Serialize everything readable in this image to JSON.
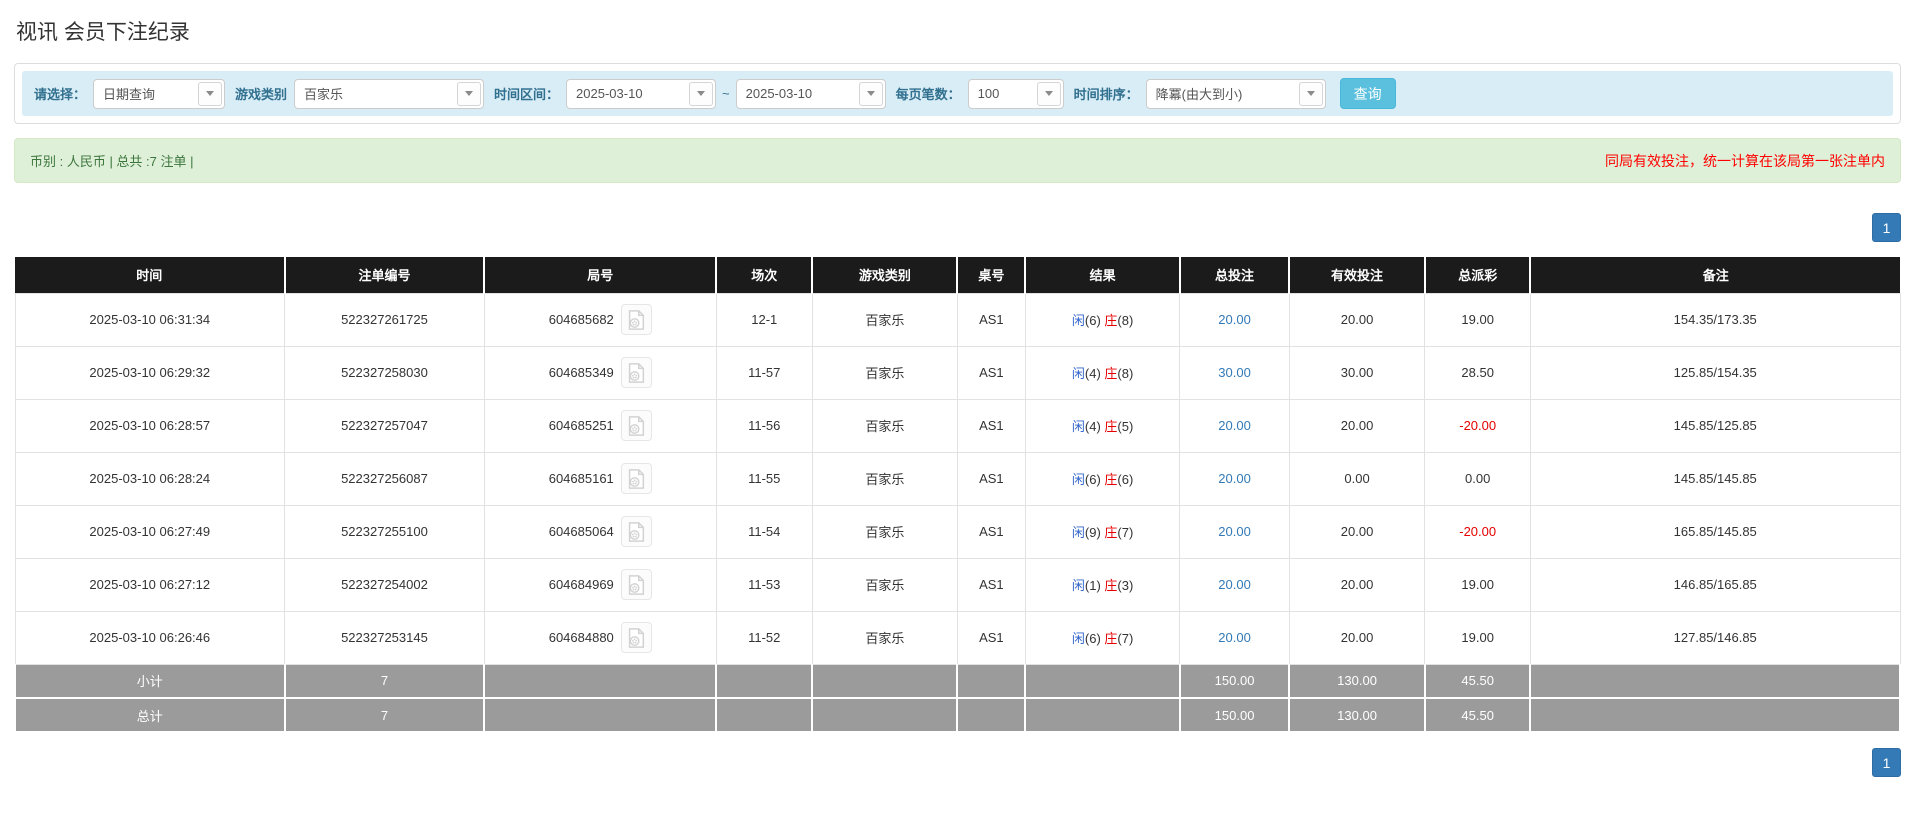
{
  "page_title": "视讯 会员下注纪录",
  "colors": {
    "accent_blue": "#337ab7",
    "search_button_blue": "#5bc0de",
    "player_blue": "#3366cc",
    "banker_red": "#e60000",
    "negative_red": "#e60000",
    "notice_red": "#ff0000",
    "summary_green_bg": "#dff0d8",
    "filter_bar_bg": "#d9edf7",
    "header_black": "#1b1b1b",
    "footer_gray": "#9b9b9b"
  },
  "filters": {
    "query_type": {
      "label": "请选择：",
      "value": "日期查询"
    },
    "game_type": {
      "label": "游戏类别",
      "value": "百家乐"
    },
    "time_range": {
      "label": "时间区间：",
      "from": "2025-03-10",
      "separator": "~",
      "to": "2025-03-10"
    },
    "page_size": {
      "label": "每页笔数：",
      "value": "100"
    },
    "time_sort": {
      "label": "时间排序：",
      "value": "降冪(由大到小)"
    },
    "search_button": "查询"
  },
  "summary_bar": {
    "info": "币别 : 人民币 | 总共 :7 注单 |",
    "notice": "同局有效投注，统一计算在该局第一张注单内"
  },
  "pagination": {
    "page": "1"
  },
  "table": {
    "columns": [
      {
        "key": "time",
        "label": "时间",
        "width": "14.3%"
      },
      {
        "key": "bet_no",
        "label": "注单编号",
        "width": "10.6%"
      },
      {
        "key": "round_no",
        "label": "局号",
        "width": "12.3%"
      },
      {
        "key": "session",
        "label": "场次",
        "width": "5.1%"
      },
      {
        "key": "game",
        "label": "游戏类别",
        "width": "7.7%"
      },
      {
        "key": "table_no",
        "label": "桌号",
        "width": "3.6%"
      },
      {
        "key": "result",
        "label": "结果",
        "width": "8.2%"
      },
      {
        "key": "total_bet",
        "label": "总投注",
        "width": "5.8%"
      },
      {
        "key": "valid_bet",
        "label": "有效投注",
        "width": "7.2%"
      },
      {
        "key": "payout",
        "label": "总派彩",
        "width": "5.6%"
      },
      {
        "key": "remark",
        "label": "备注",
        "width": "19.6%"
      }
    ],
    "rows": [
      {
        "time": "2025-03-10 06:31:34",
        "bet_no": "522327261725",
        "round_no": "604685682",
        "session": "12-1",
        "game": "百家乐",
        "table_no": "AS1",
        "result": {
          "player": "闲",
          "player_n": "(6)",
          "banker": "庄",
          "banker_n": "(8)"
        },
        "total_bet": "20.00",
        "valid_bet": "20.00",
        "payout": "19.00",
        "remark": "154.35/173.35"
      },
      {
        "time": "2025-03-10 06:29:32",
        "bet_no": "522327258030",
        "round_no": "604685349",
        "session": "11-57",
        "game": "百家乐",
        "table_no": "AS1",
        "result": {
          "player": "闲",
          "player_n": "(4)",
          "banker": "庄",
          "banker_n": "(8)"
        },
        "total_bet": "30.00",
        "valid_bet": "30.00",
        "payout": "28.50",
        "remark": "125.85/154.35"
      },
      {
        "time": "2025-03-10 06:28:57",
        "bet_no": "522327257047",
        "round_no": "604685251",
        "session": "11-56",
        "game": "百家乐",
        "table_no": "AS1",
        "result": {
          "player": "闲",
          "player_n": "(4)",
          "banker": "庄",
          "banker_n": "(5)"
        },
        "total_bet": "20.00",
        "valid_bet": "20.00",
        "payout": "-20.00",
        "remark": "145.85/125.85"
      },
      {
        "time": "2025-03-10 06:28:24",
        "bet_no": "522327256087",
        "round_no": "604685161",
        "session": "11-55",
        "game": "百家乐",
        "table_no": "AS1",
        "result": {
          "player": "闲",
          "player_n": "(6)",
          "banker": "庄",
          "banker_n": "(6)"
        },
        "total_bet": "20.00",
        "valid_bet": "0.00",
        "payout": "0.00",
        "remark": "145.85/145.85"
      },
      {
        "time": "2025-03-10 06:27:49",
        "bet_no": "522327255100",
        "round_no": "604685064",
        "session": "11-54",
        "game": "百家乐",
        "table_no": "AS1",
        "result": {
          "player": "闲",
          "player_n": "(9)",
          "banker": "庄",
          "banker_n": "(7)"
        },
        "total_bet": "20.00",
        "valid_bet": "20.00",
        "payout": "-20.00",
        "remark": "165.85/145.85"
      },
      {
        "time": "2025-03-10 06:27:12",
        "bet_no": "522327254002",
        "round_no": "604684969",
        "session": "11-53",
        "game": "百家乐",
        "table_no": "AS1",
        "result": {
          "player": "闲",
          "player_n": "(1)",
          "banker": "庄",
          "banker_n": "(3)"
        },
        "total_bet": "20.00",
        "valid_bet": "20.00",
        "payout": "19.00",
        "remark": "146.85/165.85"
      },
      {
        "time": "2025-03-10 06:26:46",
        "bet_no": "522327253145",
        "round_no": "604684880",
        "session": "11-52",
        "game": "百家乐",
        "table_no": "AS1",
        "result": {
          "player": "闲",
          "player_n": "(6)",
          "banker": "庄",
          "banker_n": "(7)"
        },
        "total_bet": "20.00",
        "valid_bet": "20.00",
        "payout": "19.00",
        "remark": "127.85/146.85"
      }
    ],
    "subtotal": {
      "label": "小计",
      "count": "7",
      "total_bet": "150.00",
      "valid_bet": "130.00",
      "payout": "45.50"
    },
    "grand_total": {
      "label": "总计",
      "count": "7",
      "total_bet": "150.00",
      "valid_bet": "130.00",
      "payout": "45.50"
    }
  }
}
